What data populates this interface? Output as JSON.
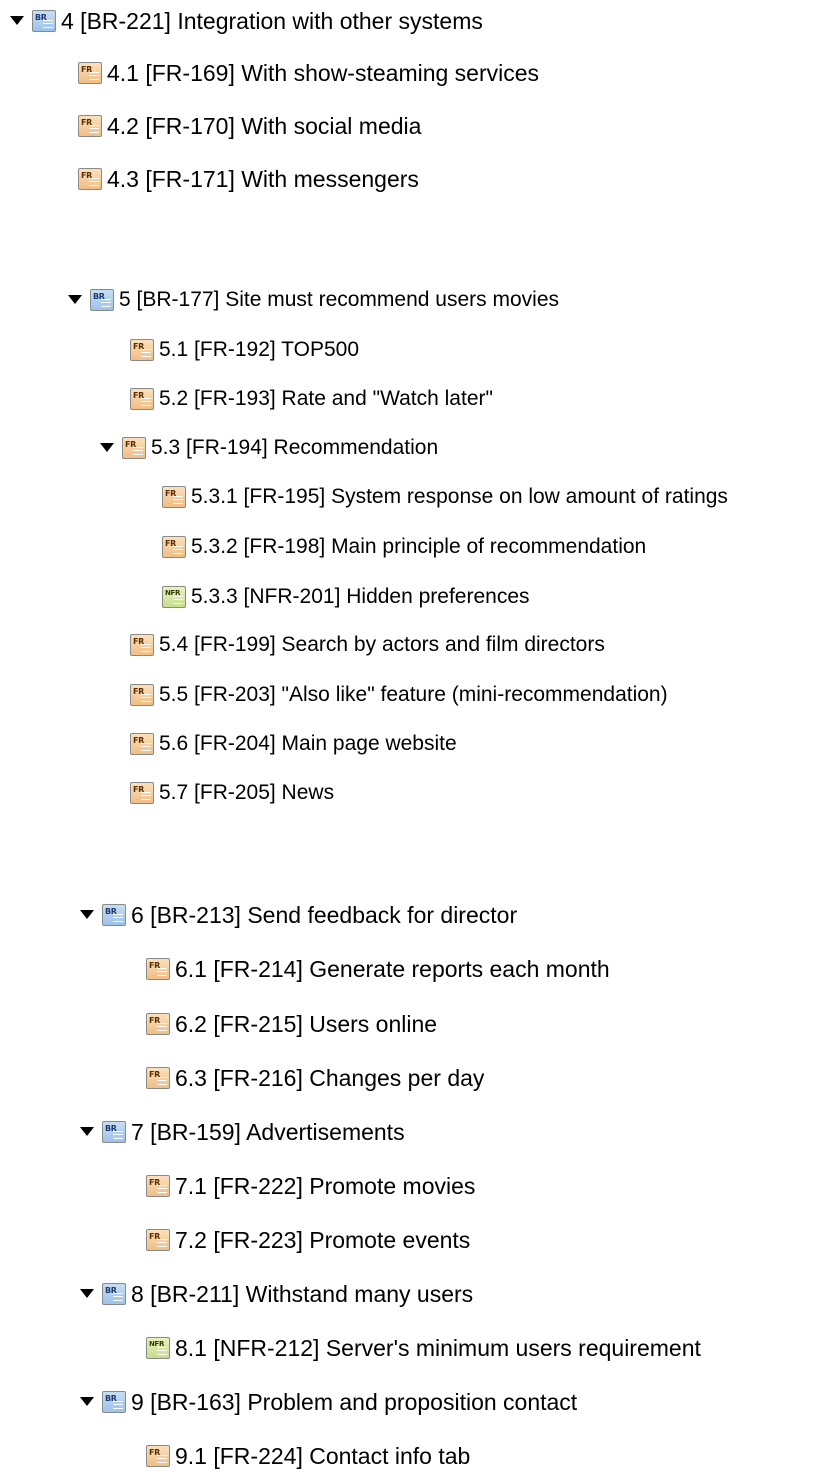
{
  "tree": {
    "items": [
      {
        "type": "BR",
        "expanded": true,
        "text": "4 [BR-221] Integration with other systems"
      },
      {
        "type": "FR",
        "expanded": null,
        "text": "4.1 [FR-169] With show-steaming services"
      },
      {
        "type": "FR",
        "expanded": null,
        "text": "4.2 [FR-170] With social media"
      },
      {
        "type": "FR",
        "expanded": null,
        "text": "4.3 [FR-171] With messengers"
      },
      {
        "type": "BR",
        "expanded": true,
        "text": "5 [BR-177] Site must recommend users movies"
      },
      {
        "type": "FR",
        "expanded": null,
        "text": "5.1 [FR-192] TOP500"
      },
      {
        "type": "FR",
        "expanded": null,
        "text": "5.2 [FR-193] Rate and \"Watch later\""
      },
      {
        "type": "FR",
        "expanded": true,
        "text": "5.3 [FR-194] Recommendation"
      },
      {
        "type": "FR",
        "expanded": null,
        "text": "5.3.1 [FR-195] System response on low amount of ratings"
      },
      {
        "type": "FR",
        "expanded": null,
        "text": "5.3.2 [FR-198] Main principle of recommendation"
      },
      {
        "type": "NFR",
        "expanded": null,
        "text": "5.3.3 [NFR-201] Hidden preferences"
      },
      {
        "type": "FR",
        "expanded": null,
        "text": "5.4 [FR-199] Search by actors and film directors"
      },
      {
        "type": "FR",
        "expanded": null,
        "text": "5.5 [FR-203] \"Also like\" feature (mini-recommendation)"
      },
      {
        "type": "FR",
        "expanded": null,
        "text": "5.6 [FR-204] Main page website"
      },
      {
        "type": "FR",
        "expanded": null,
        "text": "5.7 [FR-205] News"
      },
      {
        "type": "BR",
        "expanded": true,
        "text": "6 [BR-213] Send feedback for director"
      },
      {
        "type": "FR",
        "expanded": null,
        "text": "6.1 [FR-214] Generate reports each month"
      },
      {
        "type": "FR",
        "expanded": null,
        "text": "6.2 [FR-215] Users online"
      },
      {
        "type": "FR",
        "expanded": null,
        "text": "6.3 [FR-216] Changes per day"
      },
      {
        "type": "BR",
        "expanded": true,
        "text": "7 [BR-159] Advertisements"
      },
      {
        "type": "FR",
        "expanded": null,
        "text": "7.1 [FR-222] Promote movies"
      },
      {
        "type": "FR",
        "expanded": null,
        "text": "7.2 [FR-223] Promote events"
      },
      {
        "type": "BR",
        "expanded": true,
        "text": "8 [BR-211] Withstand many users"
      },
      {
        "type": "NFR",
        "expanded": null,
        "text": "8.1 [NFR-212] Server's minimum users requirement"
      },
      {
        "type": "BR",
        "expanded": true,
        "text": "9 [BR-163] Problem and proposition contact"
      },
      {
        "type": "FR",
        "expanded": null,
        "text": "9.1 [FR-224] Contact info tab"
      }
    ]
  },
  "icons": {
    "BR": {
      "name": "business-requirement-icon",
      "tag": "BR"
    },
    "FR": {
      "name": "functional-requirement-icon",
      "tag": "FR"
    },
    "NFR": {
      "name": "non-functional-requirement-icon",
      "tag": "NFR"
    }
  },
  "colors": {
    "br_fill": "#9dc3ea",
    "fr_fill": "#f1bd85",
    "nfr_fill": "#c6de8c",
    "text": "#000000"
  }
}
